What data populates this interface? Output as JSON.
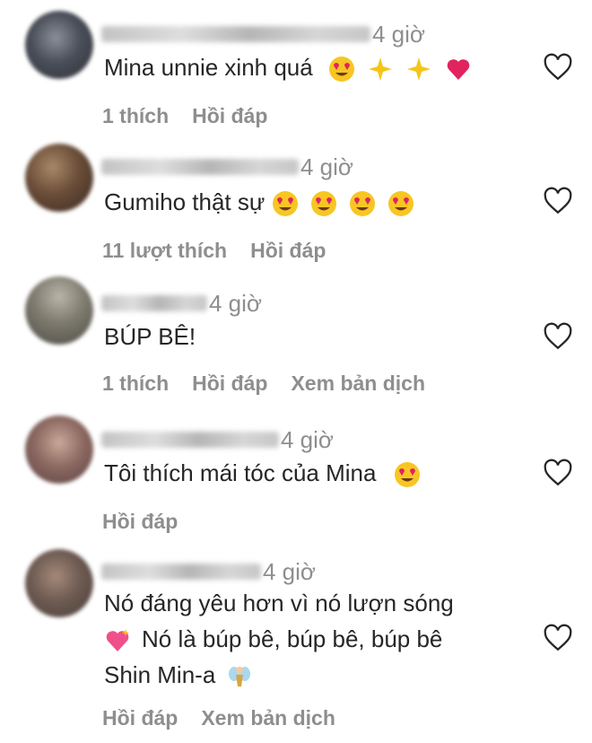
{
  "comments": [
    {
      "time": "4 giờ",
      "text": "Mina unnie xinh quá",
      "emojis": [
        "heart-eyes",
        "sparkles",
        "sparkles",
        "red-heart"
      ],
      "actions": [
        "1 thích",
        "Hồi đáp"
      ]
    },
    {
      "time": "4 giờ",
      "text": "Gumiho thật sự",
      "emojis": [
        "heart-eyes",
        "heart-eyes",
        "heart-eyes",
        "heart-eyes"
      ],
      "actions": [
        "11 lượt thích",
        "Hồi đáp"
      ]
    },
    {
      "time": "4 giờ",
      "text": "BÚP BÊ!",
      "emojis": [],
      "actions": [
        "1 thích",
        "Hồi đáp",
        "Xem bản dịch"
      ]
    },
    {
      "time": "4 giờ",
      "text": "Tôi thích mái tóc của Mina",
      "emojis": [
        "heart-eyes"
      ],
      "actions": [
        "Hồi đáp"
      ]
    },
    {
      "time": "4 giờ",
      "text_line1": "Nó đáng yêu hơn vì nó lượn sóng",
      "text_line2": "Nó là búp bê, búp bê, búp bê",
      "text_line3": "Shin Min-a",
      "emojis": [
        "sparkling-heart",
        "fairy"
      ],
      "actions": [
        "Hồi đáp",
        "Xem bản dịch"
      ]
    }
  ],
  "colors": {
    "text": "#262626",
    "muted": "#8e8e8e",
    "emoji_face": "#f7c623",
    "emoji_heart": "#e0245e"
  }
}
